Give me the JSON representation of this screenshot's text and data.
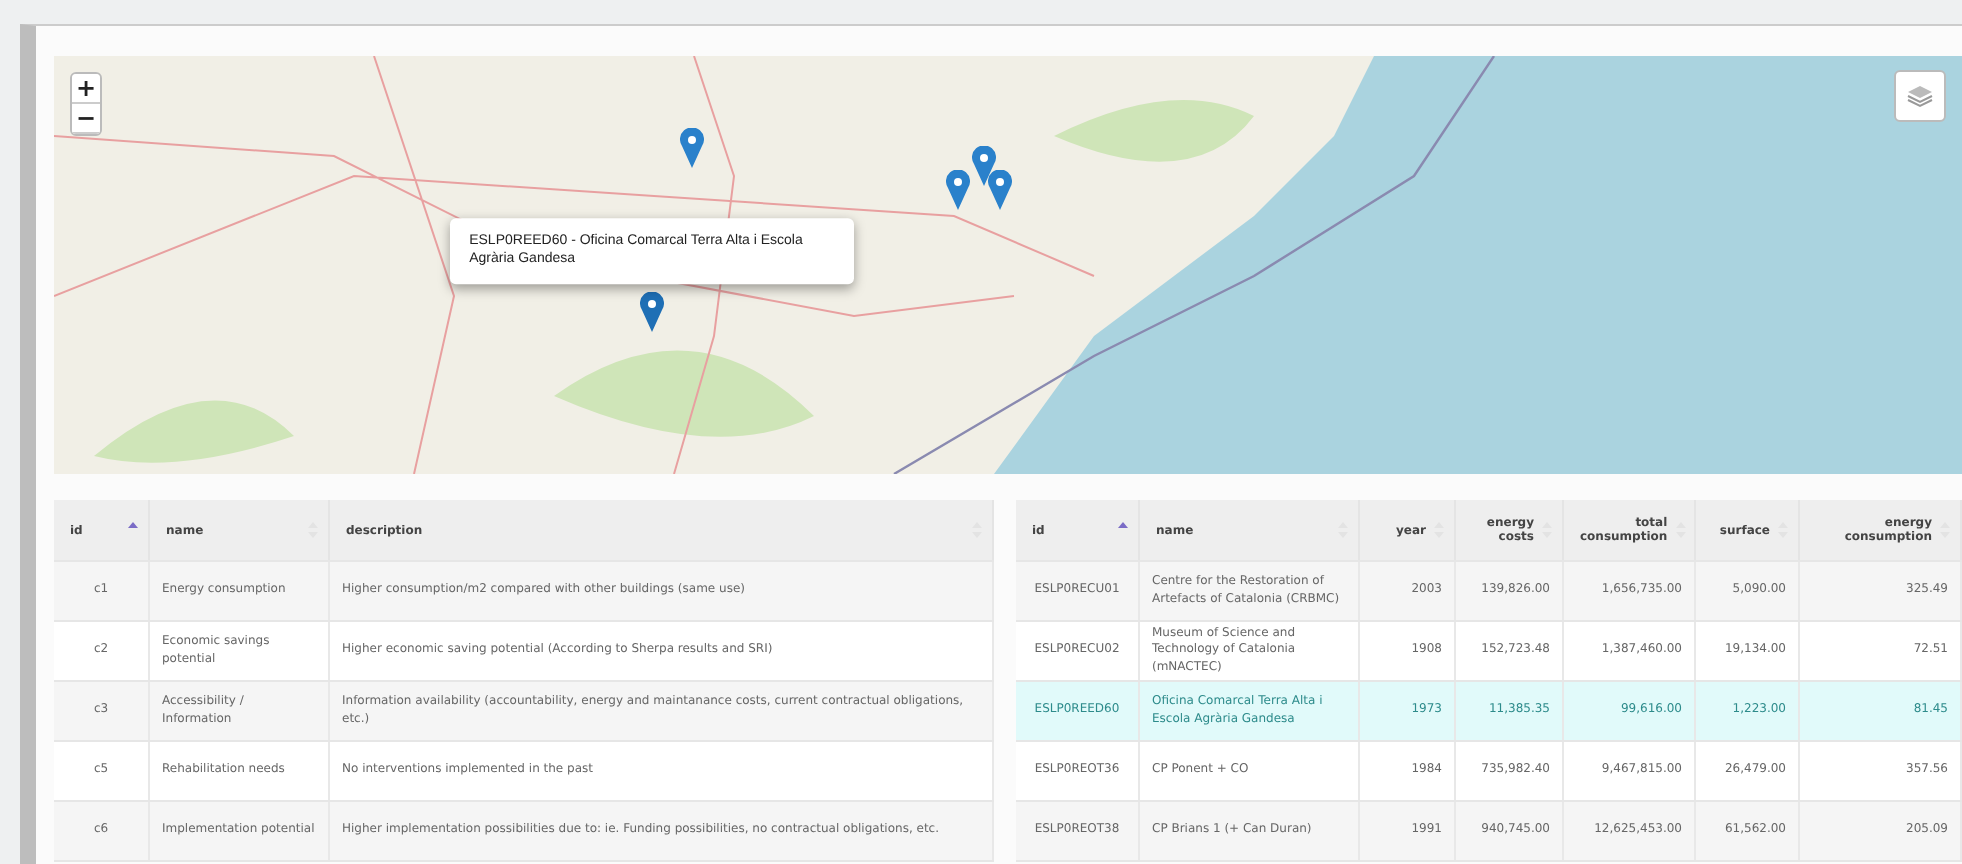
{
  "map": {
    "zoom_in": "+",
    "zoom_out": "−",
    "markers": [
      {
        "selected": false
      },
      {
        "selected": false
      },
      {
        "selected": false
      },
      {
        "selected": false
      },
      {
        "selected": true
      }
    ],
    "popup": {
      "text": "ESLP0REED60 - Oficina Comarcal Terra Alta i Escola Agrària Gandesa"
    }
  },
  "criteria_table": {
    "columns": [
      {
        "label": "id",
        "sorted": true
      },
      {
        "label": "name",
        "sorted": false
      },
      {
        "label": "description",
        "sorted": false
      }
    ],
    "rows": [
      {
        "id": "c1",
        "name": "Energy consumption",
        "description": "Higher consumption/m2 compared with other buildings (same use)"
      },
      {
        "id": "c2",
        "name": "Economic savings potential",
        "description": "Higher economic saving potential (According to Sherpa results and SRI)"
      },
      {
        "id": "c3",
        "name": "Accessibility / Information",
        "description": "Information availability (accountability, energy and maintanance costs, current contractual obligations, etc.)"
      },
      {
        "id": "c5",
        "name": "Rehabilitation needs",
        "description": "No interventions implemented in the past"
      },
      {
        "id": "c6",
        "name": "Implementation potential",
        "description": "Higher implementation possibilities due to: ie. Funding possibilities, no contractual obligations, etc."
      }
    ]
  },
  "buildings_table": {
    "columns": [
      {
        "label": "id",
        "sorted": true
      },
      {
        "label": "name",
        "sorted": false
      },
      {
        "label": "year",
        "sorted": false
      },
      {
        "label": "energy costs",
        "sorted": false
      },
      {
        "label": "total consumption",
        "sorted": false
      },
      {
        "label": "surface",
        "sorted": false
      },
      {
        "label": "energy consumption",
        "sorted": false
      }
    ],
    "rows": [
      {
        "selected": false,
        "cells": [
          "ESLP0RECU01",
          "Centre for the Restoration of Artefacts of Catalonia (CRBMC)",
          "2003",
          "139,826.00",
          "1,656,735.00",
          "5,090.00",
          "325.49"
        ]
      },
      {
        "selected": false,
        "cells": [
          "ESLP0RECU02",
          "Museum of Science and Technology of Catalonia (mNACTEC)",
          "1908",
          "152,723.48",
          "1,387,460.00",
          "19,134.00",
          "72.51"
        ]
      },
      {
        "selected": true,
        "cells": [
          "ESLP0REED60",
          "Oficina Comarcal Terra Alta i Escola Agrària Gandesa",
          "1973",
          "11,385.35",
          "99,616.00",
          "1,223.00",
          "81.45"
        ]
      },
      {
        "selected": false,
        "cells": [
          "ESLP0REOT36",
          "CP Ponent + CO",
          "1984",
          "735,982.40",
          "9,467,815.00",
          "26,479.00",
          "357.56"
        ]
      },
      {
        "selected": false,
        "cells": [
          "ESLP0REOT38",
          "CP Brians 1 (+ Can Duran)",
          "1991",
          "940,745.00",
          "12,625,453.00",
          "61,562.00",
          "205.09"
        ]
      }
    ]
  }
}
